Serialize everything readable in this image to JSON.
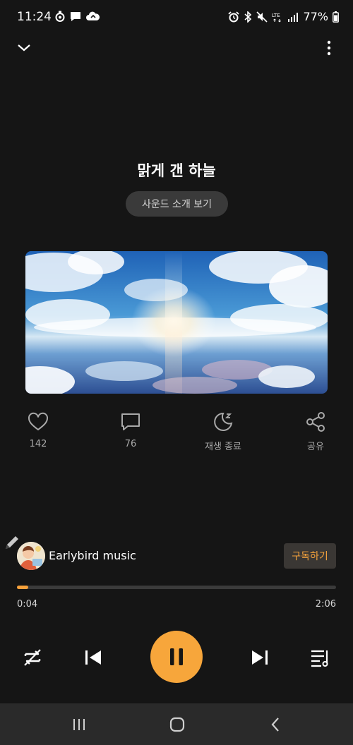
{
  "status_bar": {
    "time": "11:24",
    "battery": "77%",
    "left_icons": [
      "record-icon",
      "chat-bubble-icon",
      "cloud-sync-icon"
    ],
    "right_icons": [
      "alarm-icon",
      "bluetooth-icon",
      "mute-icon",
      "lte-icon",
      "signal-icon",
      "battery-icon"
    ],
    "lte_label": "LTE"
  },
  "player": {
    "title": "맑게 갠 하늘",
    "sound_intro_label": "사운드 소개 보기",
    "artwork_description_icon": "sky-clouds-artwork",
    "actions": [
      {
        "icon": "heart-icon",
        "label": "142"
      },
      {
        "icon": "comment-icon",
        "label": "76"
      },
      {
        "icon": "sleep-timer-icon",
        "label": "재생 종료"
      },
      {
        "icon": "share-icon",
        "label": "공유"
      }
    ],
    "channel": {
      "name": "Earlybird music",
      "subscribe_label": "구독하기"
    },
    "progress": {
      "current": "0:04",
      "total": "2:06",
      "fraction": 0.032
    }
  },
  "colors": {
    "background": "#151515",
    "accent": "#f7a63b",
    "subscribe_bg": "#3a3734",
    "muted_text": "#a9a9a9",
    "nav_bg": "#2a2a2a"
  }
}
